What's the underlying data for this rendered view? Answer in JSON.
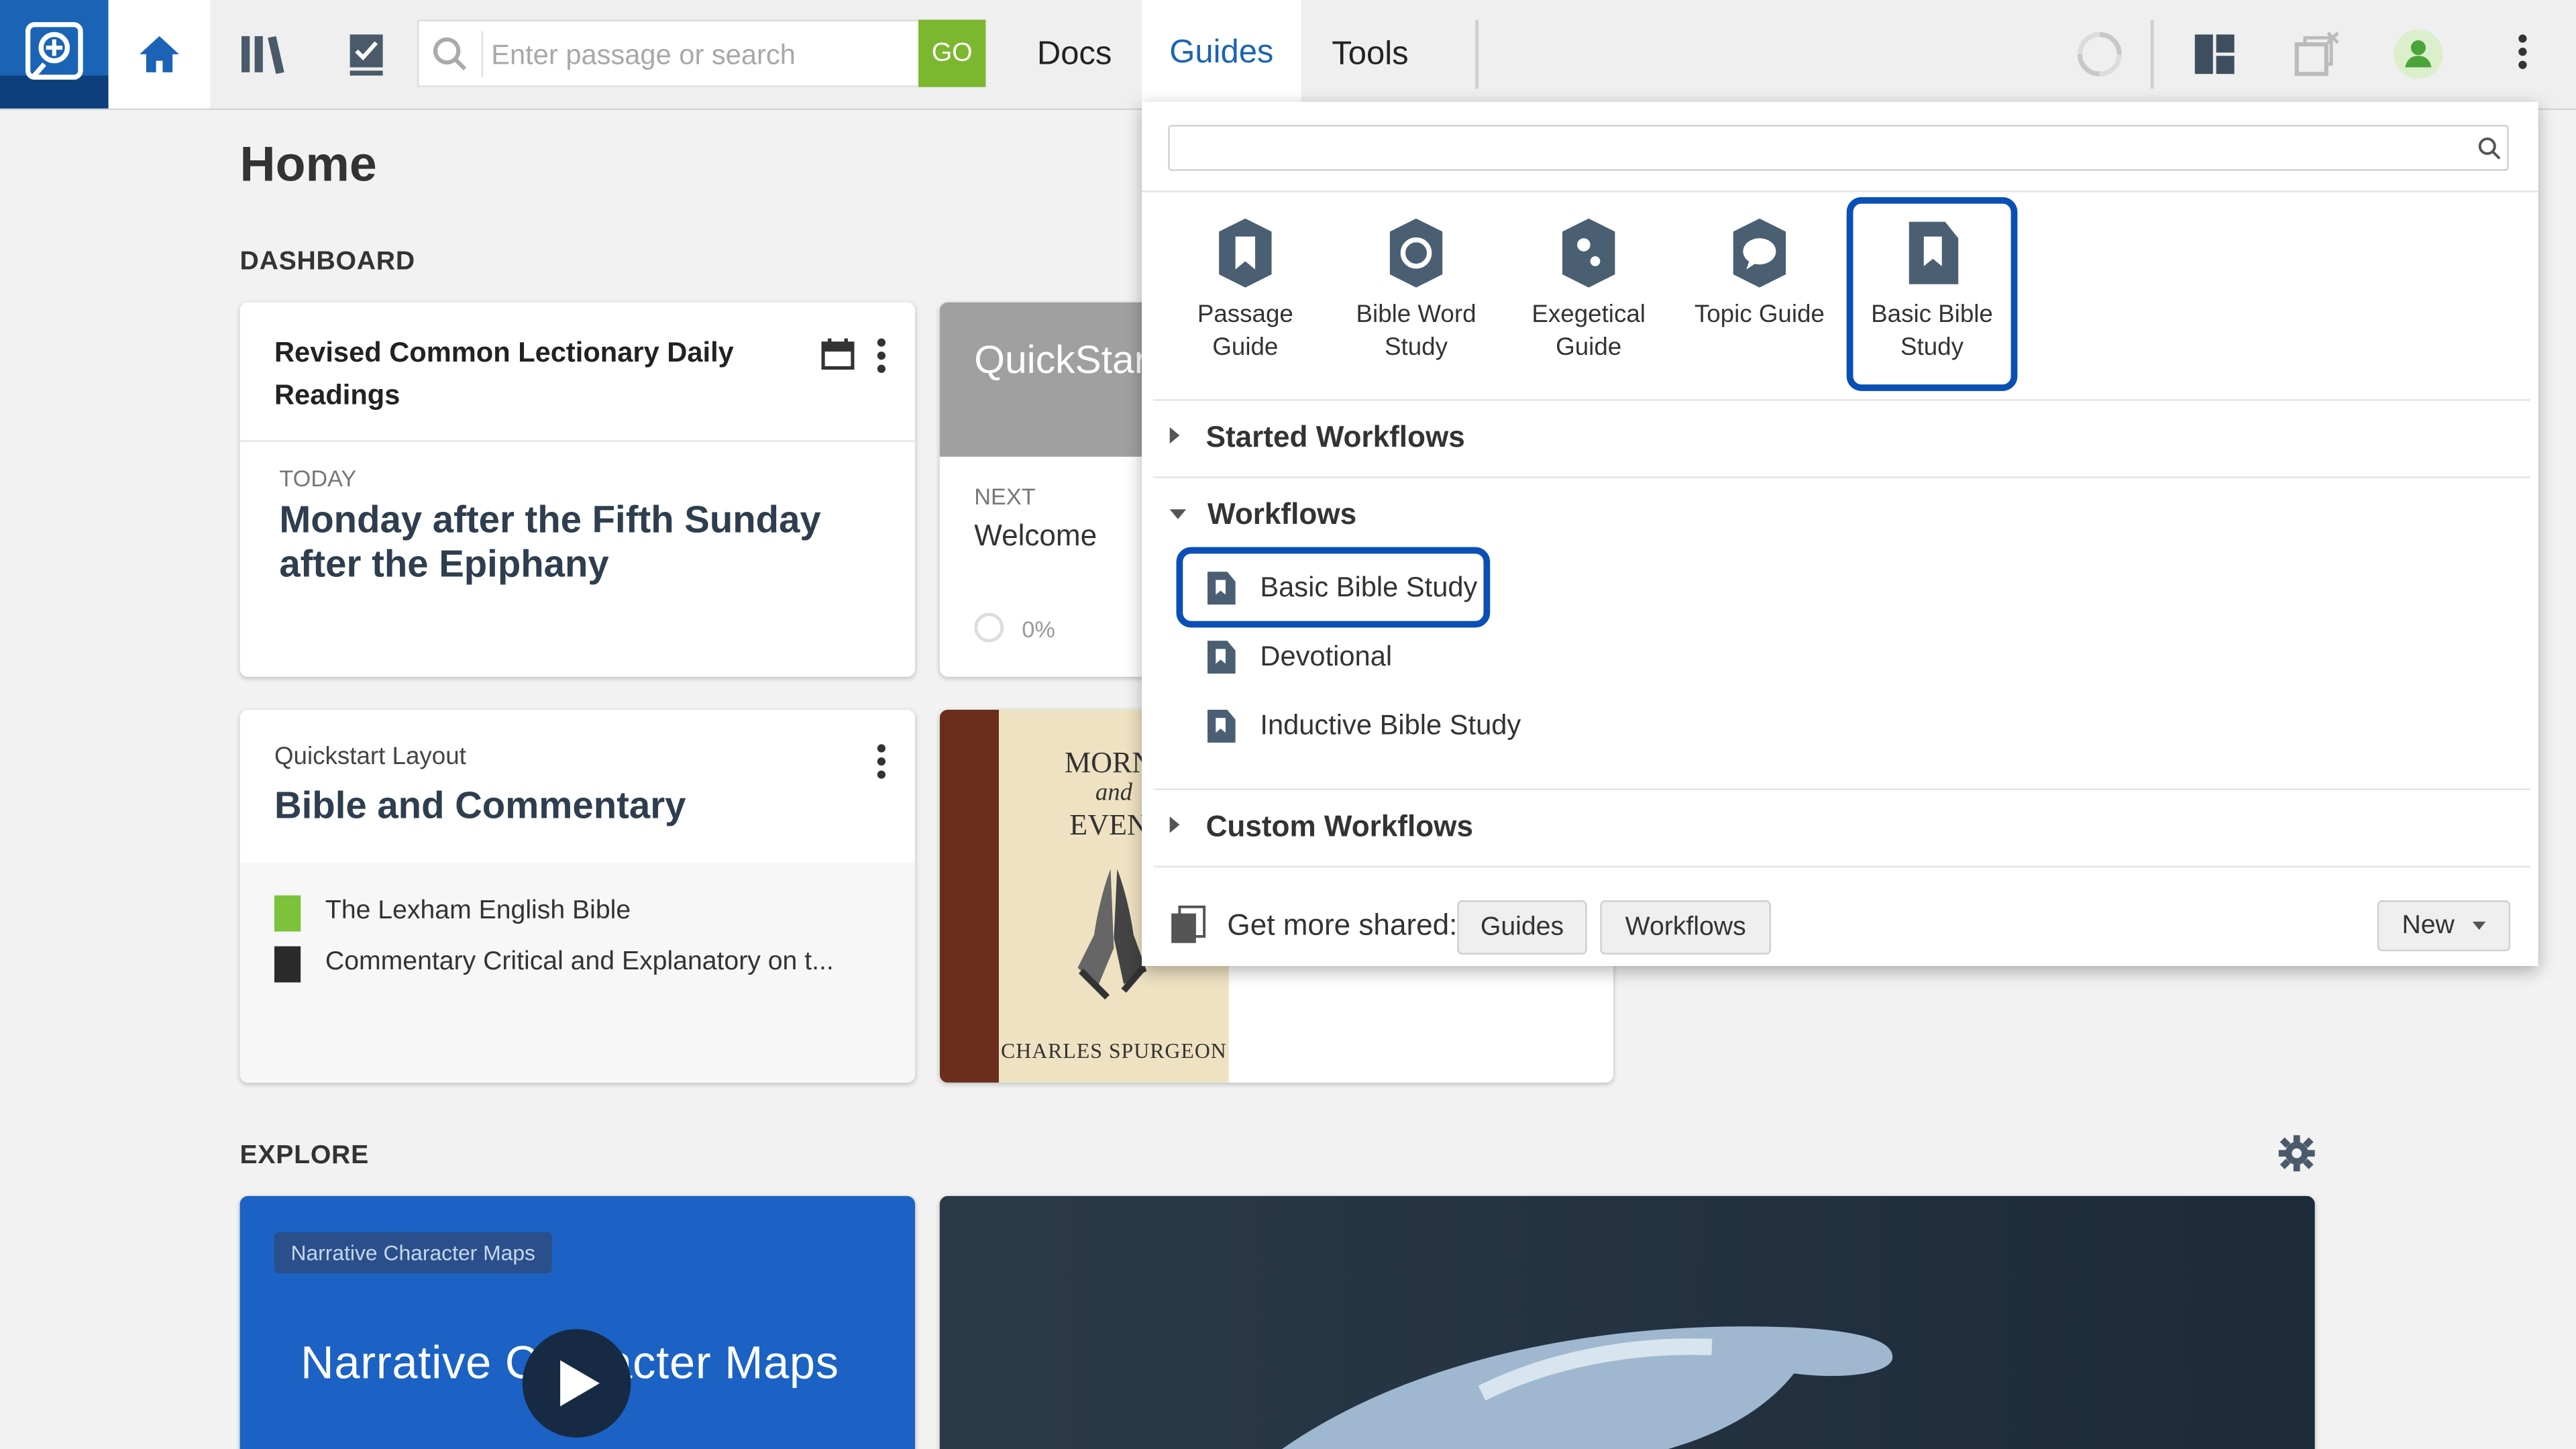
{
  "toolbar": {
    "search_placeholder": "Enter passage or search",
    "go_label": "GO",
    "tabs": [
      "Docs",
      "Guides",
      "Tools"
    ]
  },
  "home": {
    "title": "Home",
    "dashboard_label": "DASHBOARD",
    "explore_label": "EXPLORE",
    "lectionary": {
      "title": "Revised Common Lectionary Daily Readings",
      "today_label": "TODAY",
      "reading": "Monday after the Fifth Sunday after the Epiphany"
    },
    "quickstart": {
      "title": "QuickStart",
      "next_label": "NEXT",
      "next_value": "Welcome",
      "progress": "0%"
    },
    "layout_card": {
      "subtitle": "Quickstart Layout",
      "title": "Bible and Commentary",
      "items": [
        "The Lexham English Bible",
        "Commentary Critical and Explanatory on t..."
      ]
    },
    "book_cover": {
      "line1": "MORNI",
      "line2": "and",
      "line3": "EVENI",
      "author": "CHARLES SPURGEON"
    },
    "explore_video": {
      "badge": "Narrative Character Maps",
      "title": "Narrative Character Maps"
    }
  },
  "guides_panel": {
    "search_value": "",
    "guide_types": [
      {
        "line1": "Passage",
        "line2": "Guide"
      },
      {
        "line1": "Bible Word",
        "line2": "Study"
      },
      {
        "line1": "Exegetical",
        "line2": "Guide"
      },
      {
        "line1": "Topic Guide",
        "line2": ""
      },
      {
        "line1": "Basic Bible",
        "line2": "Study"
      }
    ],
    "started_workflows": "Started Workflows",
    "workflows": "Workflows",
    "workflow_items": [
      "Basic Bible Study",
      "Devotional",
      "Inductive Bible Study"
    ],
    "custom_workflows": "Custom Workflows",
    "get_more_label": "Get more shared:",
    "guides_button": "Guides",
    "workflows_button": "Workflows",
    "new_button": "New"
  },
  "colors": {
    "brand_blue": "#1b64b5",
    "go_green": "#7cb82f",
    "highlight": "#0a4fb5",
    "guide_icon": "#4b5f73"
  }
}
